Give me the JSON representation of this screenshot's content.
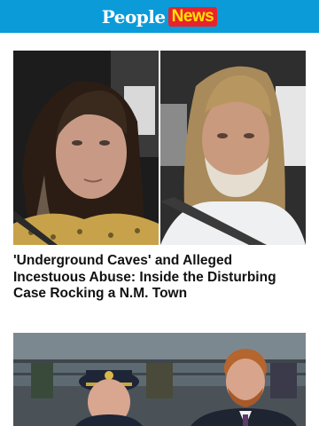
{
  "header": {
    "logo_people": "People",
    "logo_news": "News",
    "bg_color": "#0a9bd8",
    "news_bg": "#e9232b",
    "news_text": "#ffe100"
  },
  "articles": [
    {
      "headline": "'Underground Caves' and Alleged Incestuous Abuse: Inside the Disturbing Case Rocking a N.M. Town"
    }
  ]
}
